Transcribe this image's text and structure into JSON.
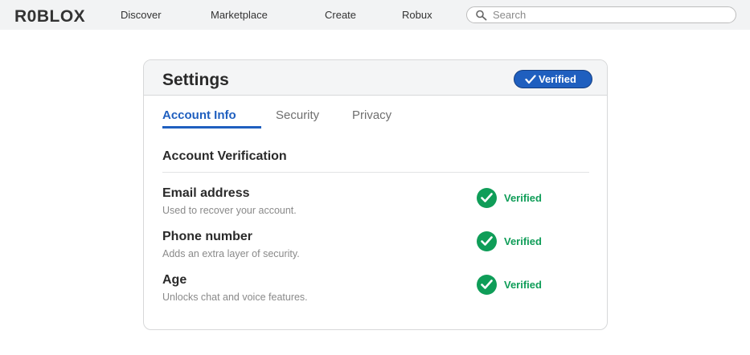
{
  "topbar": {
    "logo": "R0BLOX",
    "nav": [
      "Discover",
      "Marketplace",
      "Create",
      "Robux"
    ],
    "search": {
      "placeholder": "Search",
      "value": "",
      "icon": "search-icon"
    }
  },
  "settings": {
    "title": "Settings",
    "badge": {
      "label": "Verified",
      "icon": "check-icon",
      "color": "#1f5fbf"
    },
    "tabs": [
      {
        "label": "Account Info",
        "active": true
      },
      {
        "label": "Security",
        "active": false
      },
      {
        "label": "Privacy",
        "active": false
      }
    ],
    "section_title": "Account Verification",
    "items": [
      {
        "label": "Email address",
        "description": "Used to recover your account.",
        "status": "Verified",
        "icon": "check-circle-icon"
      },
      {
        "label": "Phone number",
        "description": "Adds an extra layer of security.",
        "status": "Verified",
        "icon": "check-circle-icon"
      },
      {
        "label": "Age",
        "description": "Unlocks chat and voice features.",
        "status": "Verified",
        "icon": "check-circle-icon"
      }
    ],
    "status_color": "#0f9d58"
  }
}
